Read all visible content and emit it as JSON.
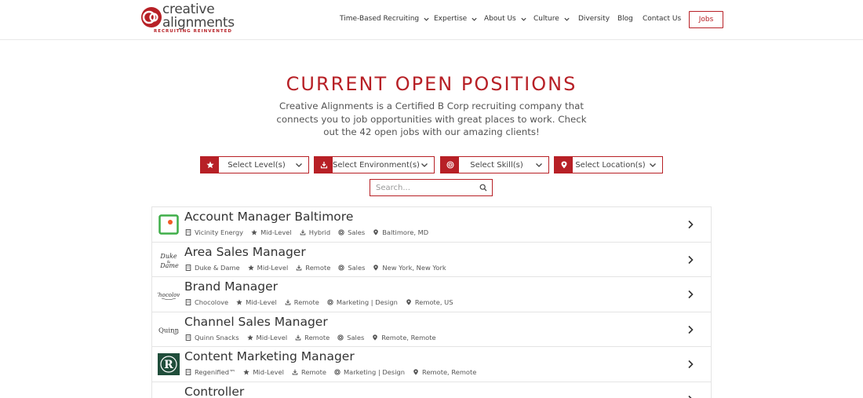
{
  "brand": {
    "name_line1": "creative",
    "name_line2": "alignments",
    "tagline": "RECRUITING REINVENTED",
    "accent_color": "#b72026"
  },
  "nav": {
    "items": [
      {
        "label": "Time-Based Recruiting",
        "has_dropdown": true
      },
      {
        "label": "Expertise",
        "has_dropdown": true
      },
      {
        "label": "About Us",
        "has_dropdown": true
      },
      {
        "label": "Culture",
        "has_dropdown": true
      },
      {
        "label": "Diversity",
        "has_dropdown": false
      },
      {
        "label": "Blog",
        "has_dropdown": false
      },
      {
        "label": "Contact Us",
        "has_dropdown": false
      }
    ],
    "jobs_button": "Jobs"
  },
  "hero": {
    "title": "CURRENT OPEN POSITIONS",
    "description": "Creative Alignments is a Certified B Corp recruiting company that connects you to job opportunities with great places to work. Check out the 42 open jobs with our amazing clients!"
  },
  "filters": [
    {
      "label": "Select Level(s)",
      "icon": "star-icon"
    },
    {
      "label": "Select Environment(s)",
      "icon": "download-icon"
    },
    {
      "label": "Select Skill(s)",
      "icon": "target-icon"
    },
    {
      "label": "Select Location(s)",
      "icon": "pin-icon"
    }
  ],
  "search": {
    "placeholder": "Search..."
  },
  "jobs": [
    {
      "title": "Account Manager Baltimore",
      "company": "Vicinity Energy",
      "level": "Mid-Level",
      "environment": "Hybrid",
      "skill": "Sales",
      "location": "Baltimore, MD",
      "logo": "vicinity-logo"
    },
    {
      "title": "Area Sales Manager",
      "company": "Duke & Dame",
      "level": "Mid-Level",
      "environment": "Remote",
      "skill": "Sales",
      "location": "New York, New York",
      "logo": "duke-dame-logo"
    },
    {
      "title": "Brand Manager",
      "company": "Chocolove",
      "level": "Mid-Level",
      "environment": "Remote",
      "skill": "Marketing | Design",
      "location": "Remote, US",
      "logo": "chocolove-logo"
    },
    {
      "title": "Channel Sales Manager",
      "company": "Quinn Snacks",
      "level": "Mid-Level",
      "environment": "Remote",
      "skill": "Sales",
      "location": "Remote, Remote",
      "logo": "quinn-logo"
    },
    {
      "title": "Content Marketing Manager",
      "company": "Regenified™",
      "level": "Mid-Level",
      "environment": "Remote",
      "skill": "Marketing | Design",
      "location": "Remote, Remote",
      "logo": "regenified-logo"
    },
    {
      "title": "Controller",
      "company": "",
      "level": "",
      "environment": "",
      "skill": "",
      "location": "",
      "logo": "company-logo"
    }
  ]
}
